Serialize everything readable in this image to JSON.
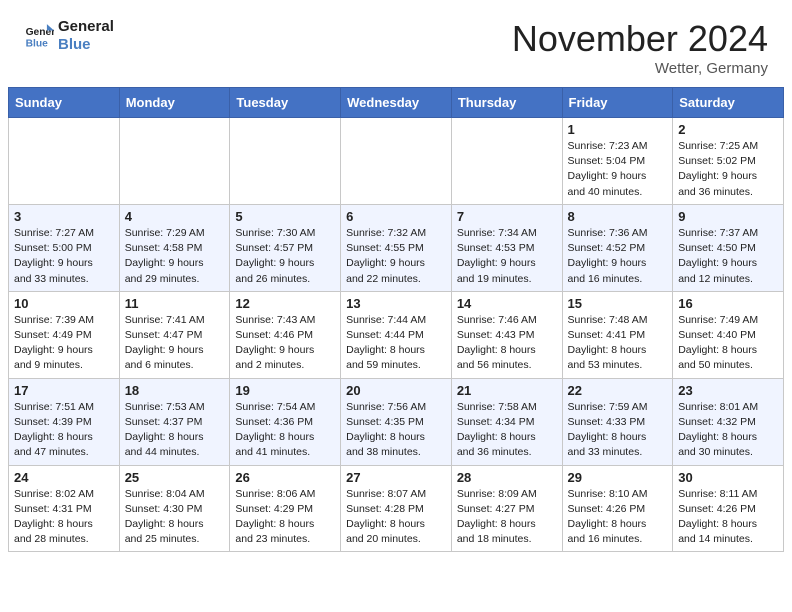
{
  "header": {
    "logo_line1": "General",
    "logo_line2": "Blue",
    "month": "November 2024",
    "location": "Wetter, Germany"
  },
  "weekdays": [
    "Sunday",
    "Monday",
    "Tuesday",
    "Wednesday",
    "Thursday",
    "Friday",
    "Saturday"
  ],
  "weeks": [
    [
      {
        "day": "",
        "detail": ""
      },
      {
        "day": "",
        "detail": ""
      },
      {
        "day": "",
        "detail": ""
      },
      {
        "day": "",
        "detail": ""
      },
      {
        "day": "",
        "detail": ""
      },
      {
        "day": "1",
        "detail": "Sunrise: 7:23 AM\nSunset: 5:04 PM\nDaylight: 9 hours\nand 40 minutes."
      },
      {
        "day": "2",
        "detail": "Sunrise: 7:25 AM\nSunset: 5:02 PM\nDaylight: 9 hours\nand 36 minutes."
      }
    ],
    [
      {
        "day": "3",
        "detail": "Sunrise: 7:27 AM\nSunset: 5:00 PM\nDaylight: 9 hours\nand 33 minutes."
      },
      {
        "day": "4",
        "detail": "Sunrise: 7:29 AM\nSunset: 4:58 PM\nDaylight: 9 hours\nand 29 minutes."
      },
      {
        "day": "5",
        "detail": "Sunrise: 7:30 AM\nSunset: 4:57 PM\nDaylight: 9 hours\nand 26 minutes."
      },
      {
        "day": "6",
        "detail": "Sunrise: 7:32 AM\nSunset: 4:55 PM\nDaylight: 9 hours\nand 22 minutes."
      },
      {
        "day": "7",
        "detail": "Sunrise: 7:34 AM\nSunset: 4:53 PM\nDaylight: 9 hours\nand 19 minutes."
      },
      {
        "day": "8",
        "detail": "Sunrise: 7:36 AM\nSunset: 4:52 PM\nDaylight: 9 hours\nand 16 minutes."
      },
      {
        "day": "9",
        "detail": "Sunrise: 7:37 AM\nSunset: 4:50 PM\nDaylight: 9 hours\nand 12 minutes."
      }
    ],
    [
      {
        "day": "10",
        "detail": "Sunrise: 7:39 AM\nSunset: 4:49 PM\nDaylight: 9 hours\nand 9 minutes."
      },
      {
        "day": "11",
        "detail": "Sunrise: 7:41 AM\nSunset: 4:47 PM\nDaylight: 9 hours\nand 6 minutes."
      },
      {
        "day": "12",
        "detail": "Sunrise: 7:43 AM\nSunset: 4:46 PM\nDaylight: 9 hours\nand 2 minutes."
      },
      {
        "day": "13",
        "detail": "Sunrise: 7:44 AM\nSunset: 4:44 PM\nDaylight: 8 hours\nand 59 minutes."
      },
      {
        "day": "14",
        "detail": "Sunrise: 7:46 AM\nSunset: 4:43 PM\nDaylight: 8 hours\nand 56 minutes."
      },
      {
        "day": "15",
        "detail": "Sunrise: 7:48 AM\nSunset: 4:41 PM\nDaylight: 8 hours\nand 53 minutes."
      },
      {
        "day": "16",
        "detail": "Sunrise: 7:49 AM\nSunset: 4:40 PM\nDaylight: 8 hours\nand 50 minutes."
      }
    ],
    [
      {
        "day": "17",
        "detail": "Sunrise: 7:51 AM\nSunset: 4:39 PM\nDaylight: 8 hours\nand 47 minutes."
      },
      {
        "day": "18",
        "detail": "Sunrise: 7:53 AM\nSunset: 4:37 PM\nDaylight: 8 hours\nand 44 minutes."
      },
      {
        "day": "19",
        "detail": "Sunrise: 7:54 AM\nSunset: 4:36 PM\nDaylight: 8 hours\nand 41 minutes."
      },
      {
        "day": "20",
        "detail": "Sunrise: 7:56 AM\nSunset: 4:35 PM\nDaylight: 8 hours\nand 38 minutes."
      },
      {
        "day": "21",
        "detail": "Sunrise: 7:58 AM\nSunset: 4:34 PM\nDaylight: 8 hours\nand 36 minutes."
      },
      {
        "day": "22",
        "detail": "Sunrise: 7:59 AM\nSunset: 4:33 PM\nDaylight: 8 hours\nand 33 minutes."
      },
      {
        "day": "23",
        "detail": "Sunrise: 8:01 AM\nSunset: 4:32 PM\nDaylight: 8 hours\nand 30 minutes."
      }
    ],
    [
      {
        "day": "24",
        "detail": "Sunrise: 8:02 AM\nSunset: 4:31 PM\nDaylight: 8 hours\nand 28 minutes."
      },
      {
        "day": "25",
        "detail": "Sunrise: 8:04 AM\nSunset: 4:30 PM\nDaylight: 8 hours\nand 25 minutes."
      },
      {
        "day": "26",
        "detail": "Sunrise: 8:06 AM\nSunset: 4:29 PM\nDaylight: 8 hours\nand 23 minutes."
      },
      {
        "day": "27",
        "detail": "Sunrise: 8:07 AM\nSunset: 4:28 PM\nDaylight: 8 hours\nand 20 minutes."
      },
      {
        "day": "28",
        "detail": "Sunrise: 8:09 AM\nSunset: 4:27 PM\nDaylight: 8 hours\nand 18 minutes."
      },
      {
        "day": "29",
        "detail": "Sunrise: 8:10 AM\nSunset: 4:26 PM\nDaylight: 8 hours\nand 16 minutes."
      },
      {
        "day": "30",
        "detail": "Sunrise: 8:11 AM\nSunset: 4:26 PM\nDaylight: 8 hours\nand 14 minutes."
      }
    ]
  ]
}
